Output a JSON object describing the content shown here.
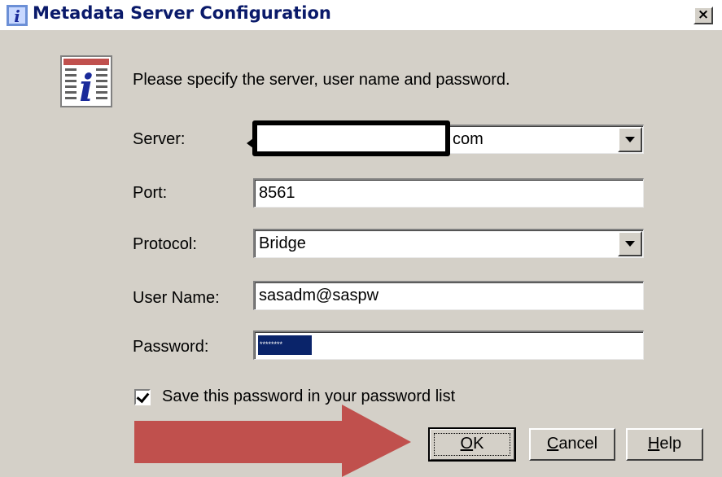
{
  "window": {
    "title": "Metadata Server Configuration",
    "close_label": "×"
  },
  "dialog": {
    "prompt": "Please specify the server, user name and password.",
    "fields": {
      "server": {
        "label": "Server:",
        "value": "com"
      },
      "port": {
        "label": "Port:",
        "value": "8561"
      },
      "protocol": {
        "label": "Protocol:",
        "value": "Bridge"
      },
      "username": {
        "label": "User Name:",
        "value": "sasadm@saspw"
      },
      "password": {
        "label": "Password:",
        "value": "********"
      }
    },
    "save_password": {
      "label": "Save this password in your password list",
      "checked": true
    },
    "buttons": {
      "ok_first": "O",
      "ok_rest": "K",
      "cancel_first": "C",
      "cancel_rest": "ancel",
      "help_first": "H",
      "help_rest": "elp"
    }
  },
  "colors": {
    "dialog_bg": "#d4d0c8",
    "title_text": "#0a1a6a",
    "selection": "#0a246a",
    "annotation_arrow": "#c0504d"
  },
  "icons": [
    "info-icon",
    "dropdown-arrow-icon",
    "checkmark-icon",
    "close-icon",
    "red-arrow-annotation"
  ]
}
